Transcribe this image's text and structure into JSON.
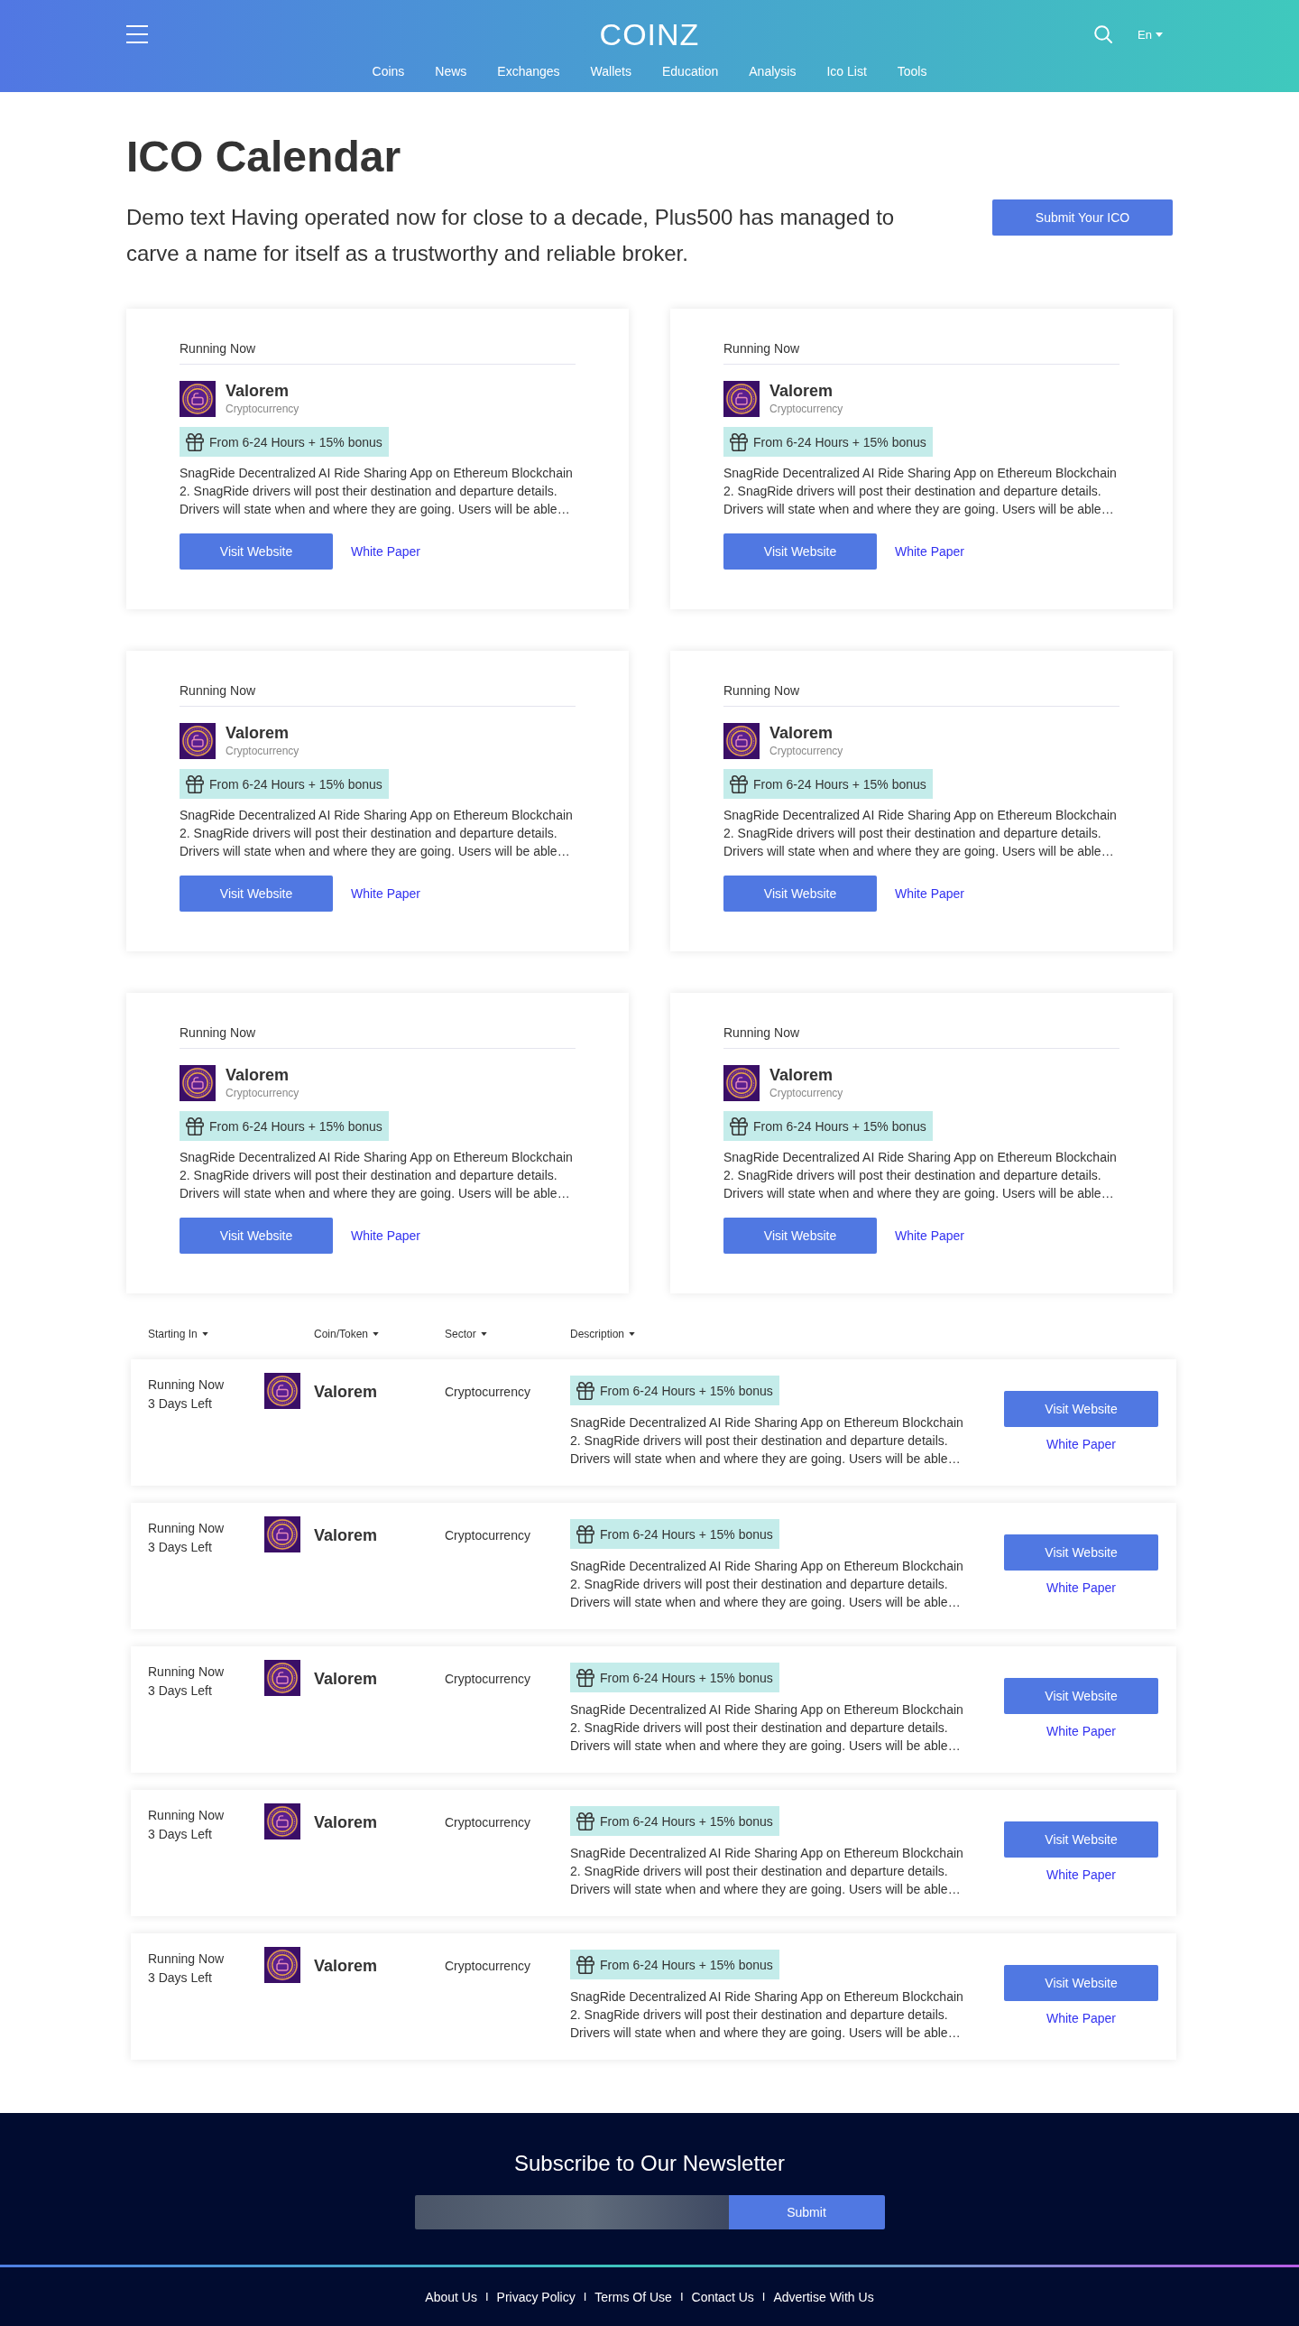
{
  "header": {
    "logo": "COINZ",
    "nav": [
      "Coins",
      "News",
      "Exchanges",
      "Wallets",
      "Education",
      "Analysis",
      "Ico List",
      "Tools"
    ],
    "language": "En"
  },
  "intro": {
    "title": "ICO Calendar",
    "text": "Demo text Having operated now for close to a decade, Plus500 has managed to carve a name for itself as a trustworthy and reliable broker.",
    "submit_button": "Submit Your ICO"
  },
  "cards": [
    {
      "status": "Running Now",
      "name": "Valorem",
      "sector": "Cryptocurrency",
      "bonus": "From 6-24 Hours + 15% bonus",
      "description": "SnagRide Decentralized AI Ride Sharing App on Ethereum Blockchain 2. SnagRide drivers will post their destination and departure details. Drivers will state when and where they are going. Users will be able…",
      "visit_button": "Visit Website",
      "white_paper": "White Paper"
    },
    {
      "status": "Running Now",
      "name": "Valorem",
      "sector": "Cryptocurrency",
      "bonus": "From 6-24 Hours + 15% bonus",
      "description": "SnagRide Decentralized AI Ride Sharing App on Ethereum Blockchain 2. SnagRide drivers will post their destination and departure details. Drivers will state when and where they are going. Users will be able…",
      "visit_button": "Visit Website",
      "white_paper": "White Paper"
    },
    {
      "status": "Running Now",
      "name": "Valorem",
      "sector": "Cryptocurrency",
      "bonus": "From 6-24 Hours + 15% bonus",
      "description": "SnagRide Decentralized AI Ride Sharing App on Ethereum Blockchain 2. SnagRide drivers will post their destination and departure details. Drivers will state when and where they are going. Users will be able…",
      "visit_button": "Visit Website",
      "white_paper": "White Paper"
    },
    {
      "status": "Running Now",
      "name": "Valorem",
      "sector": "Cryptocurrency",
      "bonus": "From 6-24 Hours + 15% bonus",
      "description": "SnagRide Decentralized AI Ride Sharing App on Ethereum Blockchain 2. SnagRide drivers will post their destination and departure details. Drivers will state when and where they are going. Users will be able…",
      "visit_button": "Visit Website",
      "white_paper": "White Paper"
    },
    {
      "status": "Running Now",
      "name": "Valorem",
      "sector": "Cryptocurrency",
      "bonus": "From 6-24 Hours + 15% bonus",
      "description": "SnagRide Decentralized AI Ride Sharing App on Ethereum Blockchain 2. SnagRide drivers will post their destination and departure details. Drivers will state when and where they are going. Users will be able…",
      "visit_button": "Visit Website",
      "white_paper": "White Paper"
    },
    {
      "status": "Running Now",
      "name": "Valorem",
      "sector": "Cryptocurrency",
      "bonus": "From 6-24 Hours + 15% bonus",
      "description": "SnagRide Decentralized AI Ride Sharing App on Ethereum Blockchain 2. SnagRide drivers will post their destination and departure details. Drivers will state when and where they are going. Users will be able…",
      "visit_button": "Visit Website",
      "white_paper": "White Paper"
    }
  ],
  "table": {
    "columns": [
      "Starting In",
      "Coin/Token",
      "Sector",
      "Description"
    ],
    "rows": [
      {
        "status": "Running Now",
        "time_left": "3 Days Left",
        "name": "Valorem",
        "sector": "Cryptocurrency",
        "bonus": "From 6-24 Hours + 15% bonus",
        "description": "SnagRide Decentralized AI Ride Sharing App on Ethereum Blockchain 2. SnagRide drivers will post their destination and departure details. Drivers will state when and where they are going. Users will be able…",
        "visit_button": "Visit Website",
        "white_paper": "White Paper"
      },
      {
        "status": "Running Now",
        "time_left": "3 Days Left",
        "name": "Valorem",
        "sector": "Cryptocurrency",
        "bonus": "From 6-24 Hours + 15% bonus",
        "description": "SnagRide Decentralized AI Ride Sharing App on Ethereum Blockchain 2. SnagRide drivers will post their destination and departure details. Drivers will state when and where they are going. Users will be able…",
        "visit_button": "Visit Website",
        "white_paper": "White Paper"
      },
      {
        "status": "Running Now",
        "time_left": "3 Days Left",
        "name": "Valorem",
        "sector": "Cryptocurrency",
        "bonus": "From 6-24 Hours + 15% bonus",
        "description": "SnagRide Decentralized AI Ride Sharing App on Ethereum Blockchain 2. SnagRide drivers will post their destination and departure details. Drivers will state when and where they are going. Users will be able…",
        "visit_button": "Visit Website",
        "white_paper": "White Paper"
      },
      {
        "status": "Running Now",
        "time_left": "3 Days Left",
        "name": "Valorem",
        "sector": "Cryptocurrency",
        "bonus": "From 6-24 Hours + 15% bonus",
        "description": "SnagRide Decentralized AI Ride Sharing App on Ethereum Blockchain 2. SnagRide drivers will post their destination and departure details. Drivers will state when and where they are going. Users will be able…",
        "visit_button": "Visit Website",
        "white_paper": "White Paper"
      },
      {
        "status": "Running Now",
        "time_left": "3 Days Left",
        "name": "Valorem",
        "sector": "Cryptocurrency",
        "bonus": "From 6-24 Hours + 15% bonus",
        "description": "SnagRide Decentralized AI Ride Sharing App on Ethereum Blockchain 2. SnagRide drivers will post their destination and departure details. Drivers will state when and where they are going. Users will be able…",
        "visit_button": "Visit Website",
        "white_paper": "White Paper"
      }
    ]
  },
  "newsletter": {
    "title": "Subscribe to Our Newsletter",
    "submit_button": "Submit"
  },
  "footer": {
    "items": [
      {
        "kind": "link",
        "label": "About Us"
      },
      {
        "kind": "separator",
        "label": "I"
      },
      {
        "kind": "link",
        "label": "Privacy Policy"
      },
      {
        "kind": "separator",
        "label": "I"
      },
      {
        "kind": "link",
        "label": "Terms Of Use"
      },
      {
        "kind": "separator",
        "label": "I"
      },
      {
        "kind": "link",
        "label": "Contact Us"
      },
      {
        "kind": "separator",
        "label": "I"
      },
      {
        "kind": "link",
        "label": "Advertise With Us"
      }
    ]
  }
}
